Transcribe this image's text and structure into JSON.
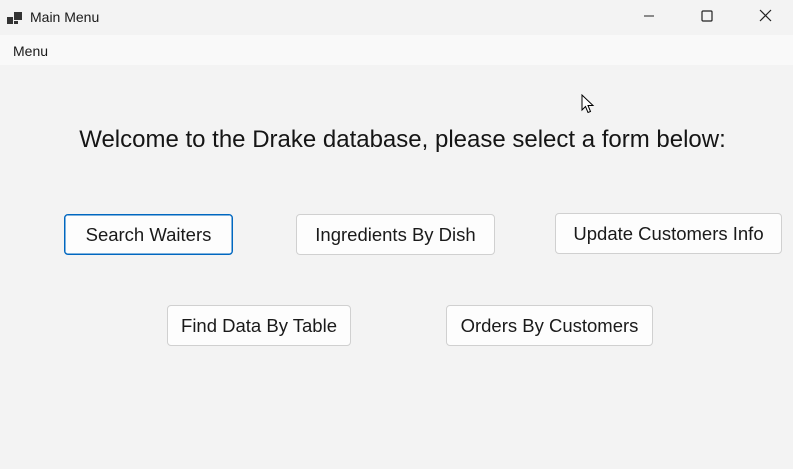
{
  "window": {
    "title": "Main Menu",
    "icon": "app-window-icon",
    "controls": [
      "minimize-icon",
      "maximize-icon",
      "close-icon"
    ]
  },
  "menubar": {
    "items": [
      {
        "label": "Menu"
      }
    ]
  },
  "main": {
    "heading": "Welcome to the Drake database, please select a form below:",
    "buttons": [
      {
        "label": "Search Waiters",
        "focused": true
      },
      {
        "label": "Ingredients By Dish",
        "focused": false
      },
      {
        "label": "Update Customers Info",
        "focused": false
      },
      {
        "label": "Find Data By Table",
        "focused": false
      },
      {
        "label": "Orders By Customers",
        "focused": false
      }
    ]
  },
  "colors": {
    "background": "#f3f3f3",
    "focus_border": "#0067c0",
    "button_bg": "#fdfdfd"
  }
}
